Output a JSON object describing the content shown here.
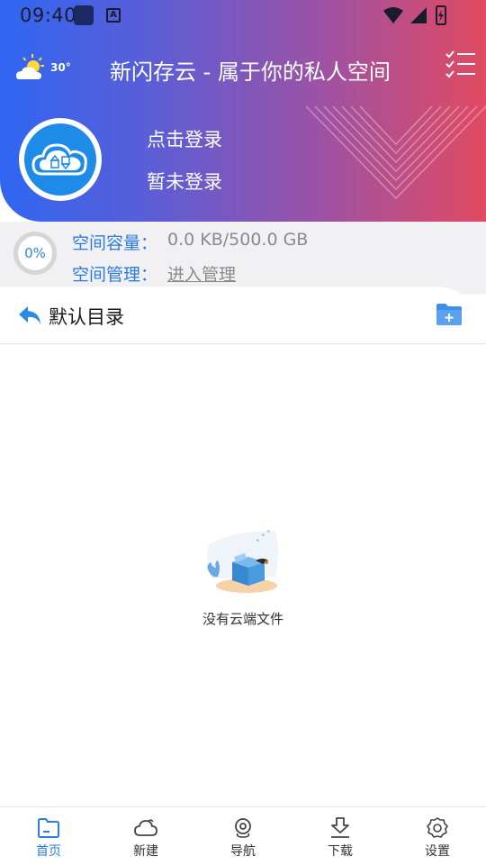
{
  "status_bar": {
    "time": "09:40"
  },
  "header": {
    "weather_temp": "30°",
    "title": "新闪存云 - 属于你的私人空间",
    "login_prompt": "点击登录",
    "login_status": "暂未登录"
  },
  "storage": {
    "percent_label": "0%",
    "usage_fraction": 0,
    "capacity_label": "空间容量：",
    "capacity_value": "0.0 KB/500.0 GB",
    "management_label": "空间管理：",
    "management_link": "进入管理"
  },
  "directory": {
    "title": "默认目录"
  },
  "empty_state": {
    "message": "没有云端文件"
  },
  "bottom_nav": {
    "items": [
      {
        "label": "首页",
        "icon": "home-folder-icon",
        "active": true
      },
      {
        "label": "新建",
        "icon": "cloud-icon",
        "active": false
      },
      {
        "label": "导航",
        "icon": "navigation-icon",
        "active": false
      },
      {
        "label": "下载",
        "icon": "download-icon",
        "active": false
      },
      {
        "label": "设置",
        "icon": "settings-gear-icon",
        "active": false
      }
    ]
  },
  "colors": {
    "gradient_start": "#2f66f2",
    "gradient_end": "#e14a62",
    "accent_blue": "#2b7ce0",
    "text_gray": "#8a8a8a"
  }
}
